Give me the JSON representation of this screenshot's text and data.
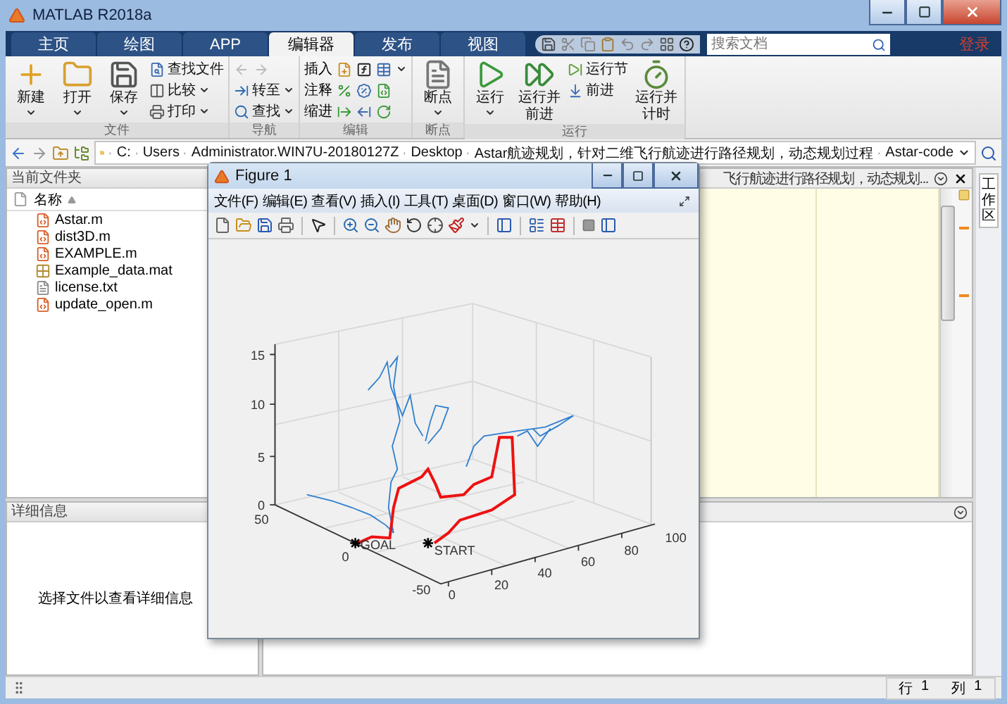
{
  "window": {
    "title": "MATLAB R2018a"
  },
  "tabs": [
    {
      "label": "主页",
      "selected": false
    },
    {
      "label": "绘图",
      "selected": false
    },
    {
      "label": "APP",
      "selected": false
    },
    {
      "label": "编辑器",
      "selected": true
    },
    {
      "label": "发布",
      "selected": false
    },
    {
      "label": "视图",
      "selected": false
    }
  ],
  "search": {
    "placeholder": "搜索文档"
  },
  "login": "登录",
  "ribbon": {
    "groups": [
      {
        "title": "文件",
        "columns": [
          [
            {
              "kind": "large",
              "label": "新建",
              "caret": true
            }
          ],
          [
            {
              "kind": "large",
              "label": "打开",
              "caret": true
            }
          ],
          [
            {
              "kind": "large",
              "label": "保存",
              "caret": true
            }
          ],
          [
            {
              "kind": "small",
              "label": "查找文件",
              "caret": false
            },
            {
              "kind": "small",
              "label": "比较",
              "caret": true
            },
            {
              "kind": "small",
              "label": "打印",
              "caret": true
            }
          ]
        ]
      },
      {
        "title": "导航",
        "columns": [
          [
            {
              "kind": "arrows",
              "disabled": true
            },
            {
              "kind": "small",
              "label": "转至",
              "caret": true
            },
            {
              "kind": "small",
              "label": "查找",
              "caret": true
            }
          ]
        ]
      },
      {
        "title": "编辑",
        "columns": [
          [
            {
              "kind": "tools",
              "label": "插入",
              "caret": true
            },
            {
              "kind": "tools",
              "label": "注释",
              "caret": false
            },
            {
              "kind": "tools",
              "label": "缩进",
              "caret": false
            }
          ]
        ]
      },
      {
        "title": "断点",
        "columns": [
          [
            {
              "kind": "large",
              "label": "断点",
              "caret": true
            }
          ]
        ]
      },
      {
        "title": "运行",
        "columns": [
          [
            {
              "kind": "large",
              "label": "运行",
              "caret": true
            }
          ],
          [
            {
              "kind": "large",
              "label": "运行并前进",
              "caret": false
            }
          ],
          [
            {
              "kind": "small",
              "label": "运行节",
              "caret": false
            },
            {
              "kind": "small",
              "label": "前进",
              "caret": false
            }
          ],
          [
            {
              "kind": "large",
              "label": "运行并计时",
              "caret": false
            }
          ]
        ]
      }
    ]
  },
  "address": [
    "C:",
    "Users",
    "Administrator.WIN7U-20180127Z",
    "Desktop",
    "Astar航迹规划，针对二维飞行航迹进行路径规划，动态规划过程",
    "Astar-code"
  ],
  "current_folder": {
    "title": "当前文件夹",
    "column": "名称",
    "files": [
      {
        "name": "Astar.m",
        "kind": "m"
      },
      {
        "name": "dist3D.m",
        "kind": "m"
      },
      {
        "name": "EXAMPLE.m",
        "kind": "m"
      },
      {
        "name": "Example_data.mat",
        "kind": "mat"
      },
      {
        "name": "license.txt",
        "kind": "txt"
      },
      {
        "name": "update_open.m",
        "kind": "m"
      }
    ]
  },
  "details": {
    "title": "详细信息",
    "message": "选择文件以查看详细信息"
  },
  "editor": {
    "tab_title": "飞行航迹进行路径规划，动态规划..."
  },
  "workspace_tab": "工作区",
  "figure": {
    "title": "Figure 1",
    "menu": [
      "文件(F)",
      "编辑(E)",
      "查看(V)",
      "插入(I)",
      "工具(T)",
      "桌面(D)",
      "窗口(W)",
      "帮助(H)"
    ],
    "z_ticks": [
      "15",
      "10",
      "5",
      "0"
    ],
    "y_ticks": [
      "50",
      "0",
      "-50"
    ],
    "x_ticks": [
      "0",
      "20",
      "40",
      "60",
      "80",
      "100"
    ],
    "goal_label": "GOAL",
    "start_label": "START"
  },
  "status_bar": {
    "row_label": "行",
    "row": "1",
    "col_label": "列",
    "col": "1"
  }
}
